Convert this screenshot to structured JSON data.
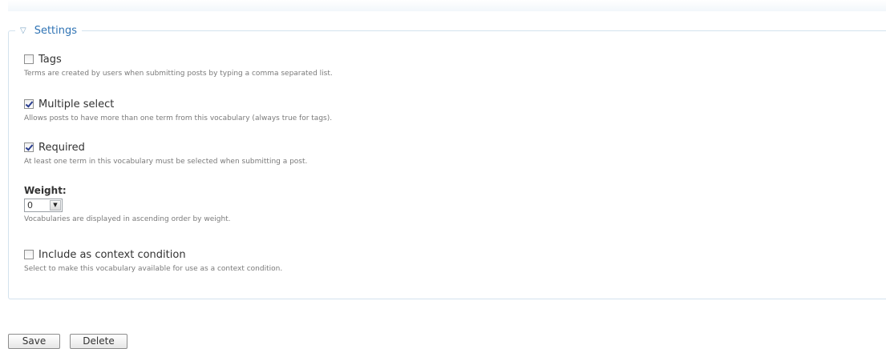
{
  "settings": {
    "legend_icon": "triangle-down-icon",
    "legend": "Settings",
    "tags": {
      "label": "Tags",
      "checked": false,
      "description": "Terms are created by users when submitting posts by typing a comma separated list."
    },
    "multiple": {
      "label": "Multiple select",
      "checked": true,
      "description": "Allows posts to have more than one term from this vocabulary (always true for tags)."
    },
    "required": {
      "label": "Required",
      "checked": true,
      "description": "At least one term in this vocabulary must be selected when submitting a post."
    },
    "weight": {
      "label": "Weight:",
      "value": "0",
      "description": "Vocabularies are displayed in ascending order by weight."
    },
    "context": {
      "label": "Include as context condition",
      "checked": false,
      "description": "Select to make this vocabulary available for use as a context condition."
    }
  },
  "actions": {
    "save": "Save",
    "delete": "Delete"
  }
}
